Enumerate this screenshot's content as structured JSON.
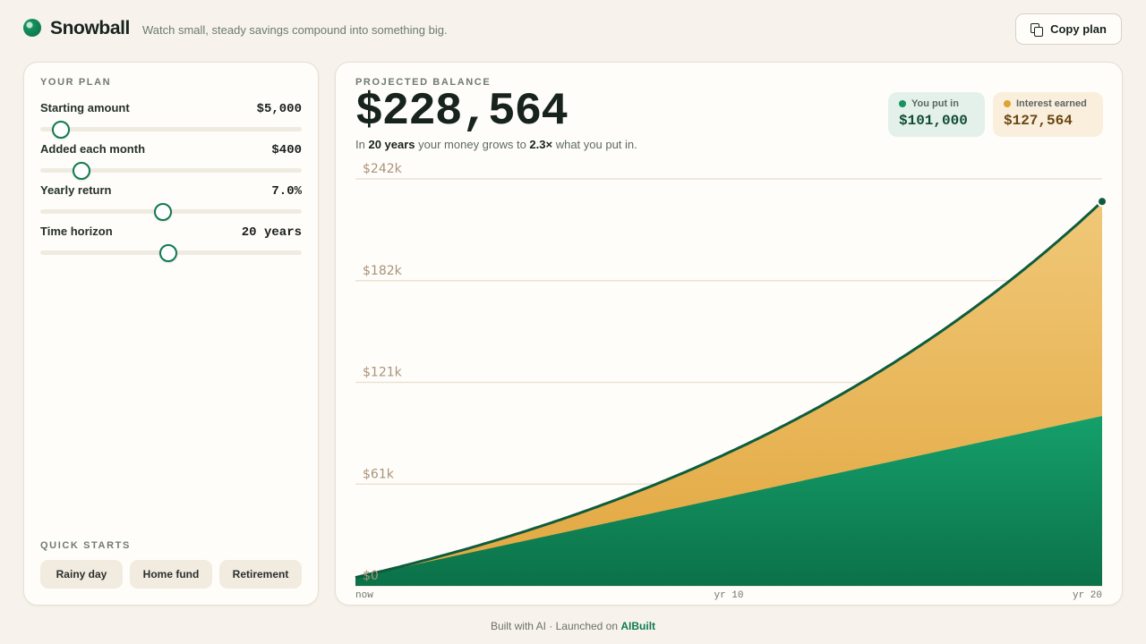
{
  "header": {
    "brand": "Snowball",
    "tagline": "Watch small, steady savings compound into something big.",
    "copy_label": "Copy plan"
  },
  "plan": {
    "title": "YOUR PLAN",
    "controls": [
      {
        "label": "Starting amount",
        "value": "$5,000",
        "fraction": 0.08
      },
      {
        "label": "Added each month",
        "value": "$400",
        "fraction": 0.157
      },
      {
        "label": "Yearly return",
        "value": "7.0%",
        "fraction": 0.468
      },
      {
        "label": "Time horizon",
        "value": "20 years",
        "fraction": 0.49
      }
    ],
    "quick_title": "QUICK STARTS",
    "quick": [
      "Rainy day",
      "Home fund",
      "Retirement"
    ]
  },
  "projection": {
    "label": "PROJECTED BALANCE",
    "balance": "$228,564",
    "summary_pre": "In ",
    "years": "20 years",
    "summary_mid": " your money grows to ",
    "multiple": "2.3×",
    "summary_post": " what you put in.",
    "put_label": "You put in",
    "put_value": "$101,000",
    "interest_label": "Interest earned",
    "interest_value": "$127,564"
  },
  "colors": {
    "accent": "#0f7a52",
    "contrib_top": "#15a06b",
    "contrib_bottom": "#0c7148",
    "interest_top": "#f0c878",
    "interest_bottom": "#e2a73f",
    "line": "#0d5c3d",
    "grid": "#ece2d4"
  },
  "chart_data": {
    "type": "area",
    "x_ticks": [
      "now",
      "yr 10",
      "yr 20"
    ],
    "y_ticks": [
      "$0",
      "$61k",
      "$121k",
      "$182k",
      "$242k"
    ],
    "ylim": [
      0,
      242000
    ],
    "xlim": [
      0,
      20
    ],
    "years": 20,
    "start": 5000,
    "monthly": 400,
    "rate": 0.07,
    "series": [
      {
        "name": "You put in",
        "final": 101000
      },
      {
        "name": "Interest earned",
        "final": 127564
      }
    ]
  },
  "footer": {
    "text": "Built with AI · Launched on ",
    "link": "AIBuilt"
  }
}
